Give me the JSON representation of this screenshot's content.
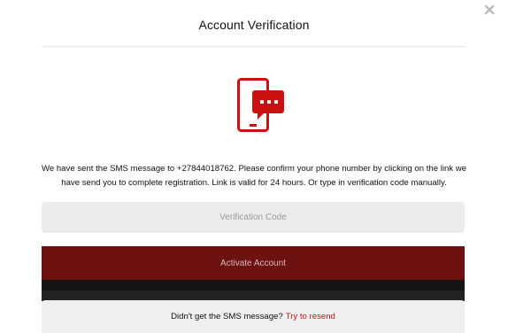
{
  "dialog": {
    "title": "Account Verification",
    "close_icon": "close-icon",
    "phone_icon": "phone-chat-icon",
    "accent_color": "#cc1111",
    "message": "We have sent the SMS message to +27844018762. Please confirm your phone number by clicking on the link we have send you to complete registration. Link is valid for 24 hours. Or type in verification code manually.",
    "code_field": {
      "placeholder": "Verification Code",
      "value": ""
    },
    "activate_button": {
      "label": "Activate Account",
      "color": "#6e1111"
    },
    "resend": {
      "prompt": "Didn't get the SMS message?",
      "link_label": "Try to resend"
    }
  }
}
